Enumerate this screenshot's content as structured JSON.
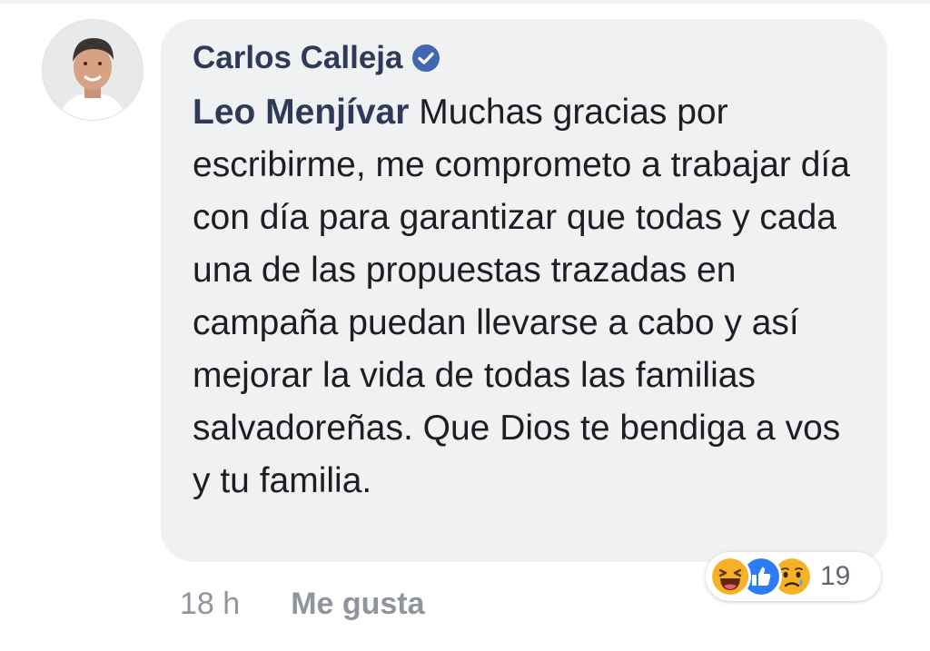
{
  "comment": {
    "author": "Carlos Calleja",
    "verified_icon": "verified-badge-icon",
    "mention": "Leo Menjívar",
    "text": " Muchas gracias por escribirme, me comprometo a trabajar día con día para garantizar que todas y cada una de las propuestas trazadas en campaña puedan llevarse a cabo y así mejorar la vida de todas las familias salvadoreñas. Que Dios te bendiga a vos y tu familia.",
    "timestamp": "18 h",
    "like_label": "Me gusta"
  },
  "reactions": {
    "icons": [
      "haha-reaction-icon",
      "like-reaction-icon",
      "sad-reaction-icon"
    ],
    "count": "19"
  },
  "colors": {
    "bubble": "#f0f1f3",
    "author": "#2f3a59",
    "verified": "#4267b2",
    "like_blue": "#2d7cf6",
    "meta": "#90949c"
  }
}
